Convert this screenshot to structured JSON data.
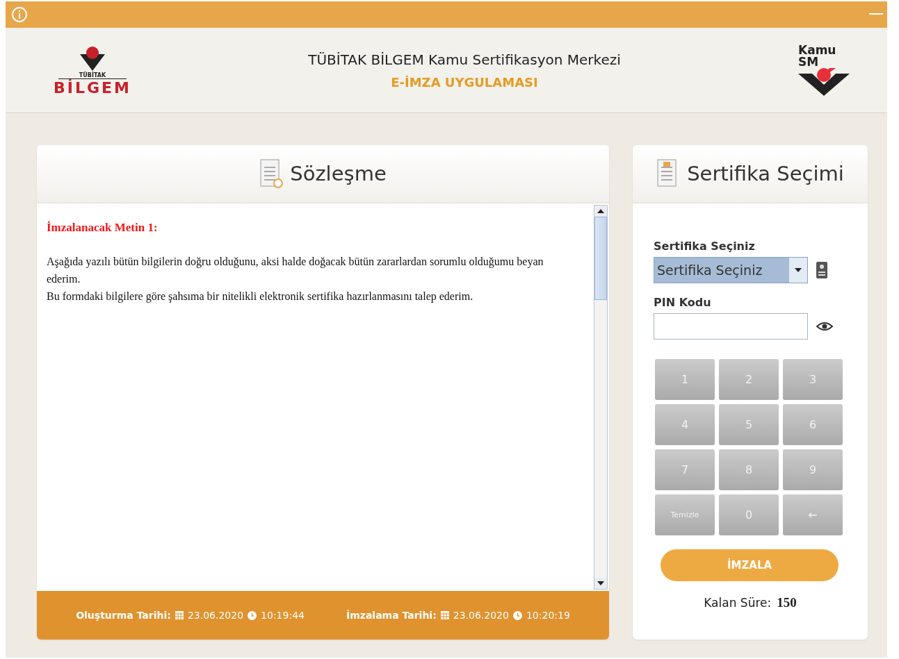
{
  "header": {
    "title": "TÜBİTAK BİLGEM Kamu Sertifikasyon Merkezi",
    "subtitle": "E-İMZA UYGULAMASI",
    "left_logo": {
      "small_text": "TÜBİTAK",
      "big_text": "BİLGEM"
    },
    "right_logo": {
      "line_1": "Kamu",
      "line_2": "SM"
    }
  },
  "contract": {
    "title": "Sözleşme",
    "heading": "İmzalanacak Metin 1:",
    "paragraphs": [
      "Aşağıda yazılı bütün bilgilerin doğru olduğunu, aksi halde doğacak bütün zararlardan sorumlu olduğumu beyan ederim.",
      "Bu formdaki bilgilere göre şahsıma bir nitelikli elektronik sertifika hazırlanmasını talep ederim."
    ],
    "footer": [
      {
        "label": "Oluşturma Tarihi:",
        "date": "23.06.2020",
        "time": "10:19:44"
      },
      {
        "label": "İmzalama Tarihi:",
        "date": "23.06.2020",
        "time": "10:20:19"
      }
    ]
  },
  "certificate": {
    "title": "Sertifika Seçimi",
    "select_label": "Sertifika Seçiniz",
    "select_value": "Sertifika Seçiniz",
    "pin_label": "PIN Kodu",
    "keys": [
      {
        "label": "1",
        "kind": "digit"
      },
      {
        "label": "2",
        "kind": "digit"
      },
      {
        "label": "3",
        "kind": "digit"
      },
      {
        "label": "4",
        "kind": "digit"
      },
      {
        "label": "5",
        "kind": "digit"
      },
      {
        "label": "6",
        "kind": "digit"
      },
      {
        "label": "7",
        "kind": "digit"
      },
      {
        "label": "8",
        "kind": "digit"
      },
      {
        "label": "9",
        "kind": "digit"
      },
      {
        "label": "Temizle",
        "kind": "word"
      },
      {
        "label": "0",
        "kind": "digit"
      },
      {
        "label": "←",
        "kind": "digit"
      }
    ],
    "sign_button": "İMZALA",
    "remaining_label": "Kalan Süre:",
    "remaining_value": "150"
  }
}
